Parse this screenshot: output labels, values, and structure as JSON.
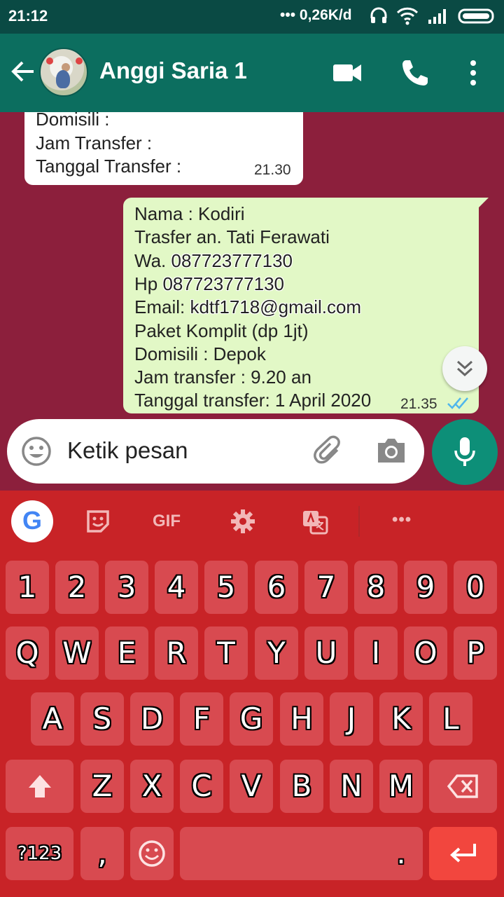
{
  "status_bar": {
    "time": "21:12",
    "network_speed": "••• 0,26K/d"
  },
  "header": {
    "contact_name": "Anggi Saria 1"
  },
  "messages": {
    "incoming": {
      "lines": [
        "Domisili :",
        "Jam Transfer :",
        "Tanggal Transfer :"
      ],
      "time": "21.30"
    },
    "outgoing": {
      "lines": [
        {
          "prefix": "Nama : Kodiri",
          "value": ""
        },
        {
          "prefix": "Trasfer an. Tati Ferawati",
          "value": ""
        },
        {
          "prefix": "Wa. ",
          "value": "087723777130"
        },
        {
          "prefix": "Hp ",
          "value": "087723777130"
        },
        {
          "prefix": "Email: ",
          "value": "kdtf1718@gmail.com"
        },
        {
          "prefix": "Paket Komplit (dp 1jt)",
          "value": ""
        },
        {
          "prefix": "Domisili : Depok",
          "value": ""
        },
        {
          "prefix": "Jam transfer : 9.20 an",
          "value": ""
        },
        {
          "prefix": "Tanggal transfer: 1 April 2020",
          "value": ""
        }
      ],
      "time": "21.35",
      "status_icon": "double-check-read-icon"
    }
  },
  "composer": {
    "placeholder": "Ketik pesan"
  },
  "keyboard": {
    "toolbar": {
      "google": "G",
      "gif": "GIF",
      "more": "•••"
    },
    "row_numbers": [
      "1",
      "2",
      "3",
      "4",
      "5",
      "6",
      "7",
      "8",
      "9",
      "0"
    ],
    "row_1": [
      "Q",
      "W",
      "E",
      "R",
      "T",
      "Y",
      "U",
      "I",
      "O",
      "P"
    ],
    "row_2": [
      "A",
      "S",
      "D",
      "F",
      "G",
      "H",
      "J",
      "K",
      "L"
    ],
    "row_3": [
      "Z",
      "X",
      "C",
      "V",
      "B",
      "N",
      "M"
    ],
    "bottom": {
      "symbols": "?123",
      "comma": ",",
      "period": "."
    }
  },
  "colors": {
    "header": "#0c6e5f",
    "chat_background": "#8c1f3c",
    "outgoing_bubble": "#e2f8c6",
    "keyboard": "#c82327",
    "key": "#d84a50",
    "mic_button": "#0d8f78"
  }
}
